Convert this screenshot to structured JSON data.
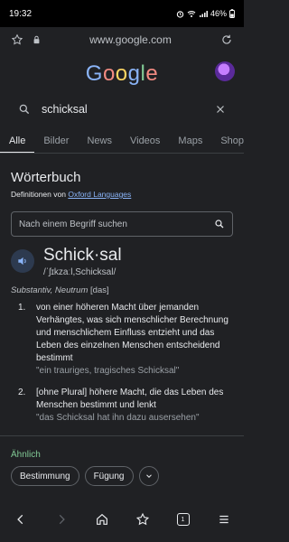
{
  "status": {
    "time": "19:32",
    "battery": "46%"
  },
  "browser": {
    "url": "www.google.com"
  },
  "logo": {
    "letters": [
      "G",
      "o",
      "o",
      "g",
      "l",
      "e"
    ],
    "colors": [
      "#8ab4f8",
      "#f28b82",
      "#fdd663",
      "#8ab4f8",
      "#81c995",
      "#f28b82"
    ]
  },
  "search": {
    "query": "schicksal"
  },
  "tabs": [
    "Alle",
    "Bilder",
    "News",
    "Videos",
    "Maps",
    "Shoppi"
  ],
  "dictionary": {
    "title": "Wörterbuch",
    "source_prefix": "Definitionen von",
    "source_link": "Oxford Languages",
    "search_placeholder": "Nach einem Begriff suchen",
    "headword": "Schick·sal",
    "phonetic": "/ˈʃɪkzaːl,Schicksal/",
    "grammar_italic": "Substantiv, Neutrum",
    "grammar_tag": "[das]",
    "definitions": [
      {
        "num": "1.",
        "text": "von einer höheren Macht über jemanden Verhängtes, was sich menschlicher Berechnung und menschlichem Einfluss entzieht und das Leben des einzelnen Menschen entscheidend bestimmt",
        "example": "\"ein trauriges, tragisches Schicksal\""
      },
      {
        "num": "2.",
        "text": "[ohne Plural] höhere Macht, die das Leben des Menschen bestimmt und lenkt",
        "example": "\"das Schicksal hat ihn dazu ausersehen\""
      }
    ],
    "similar_label": "Ähnlich",
    "similar": [
      "Bestimmung",
      "Fügung"
    ]
  },
  "nav": {
    "tab_count": "1"
  }
}
